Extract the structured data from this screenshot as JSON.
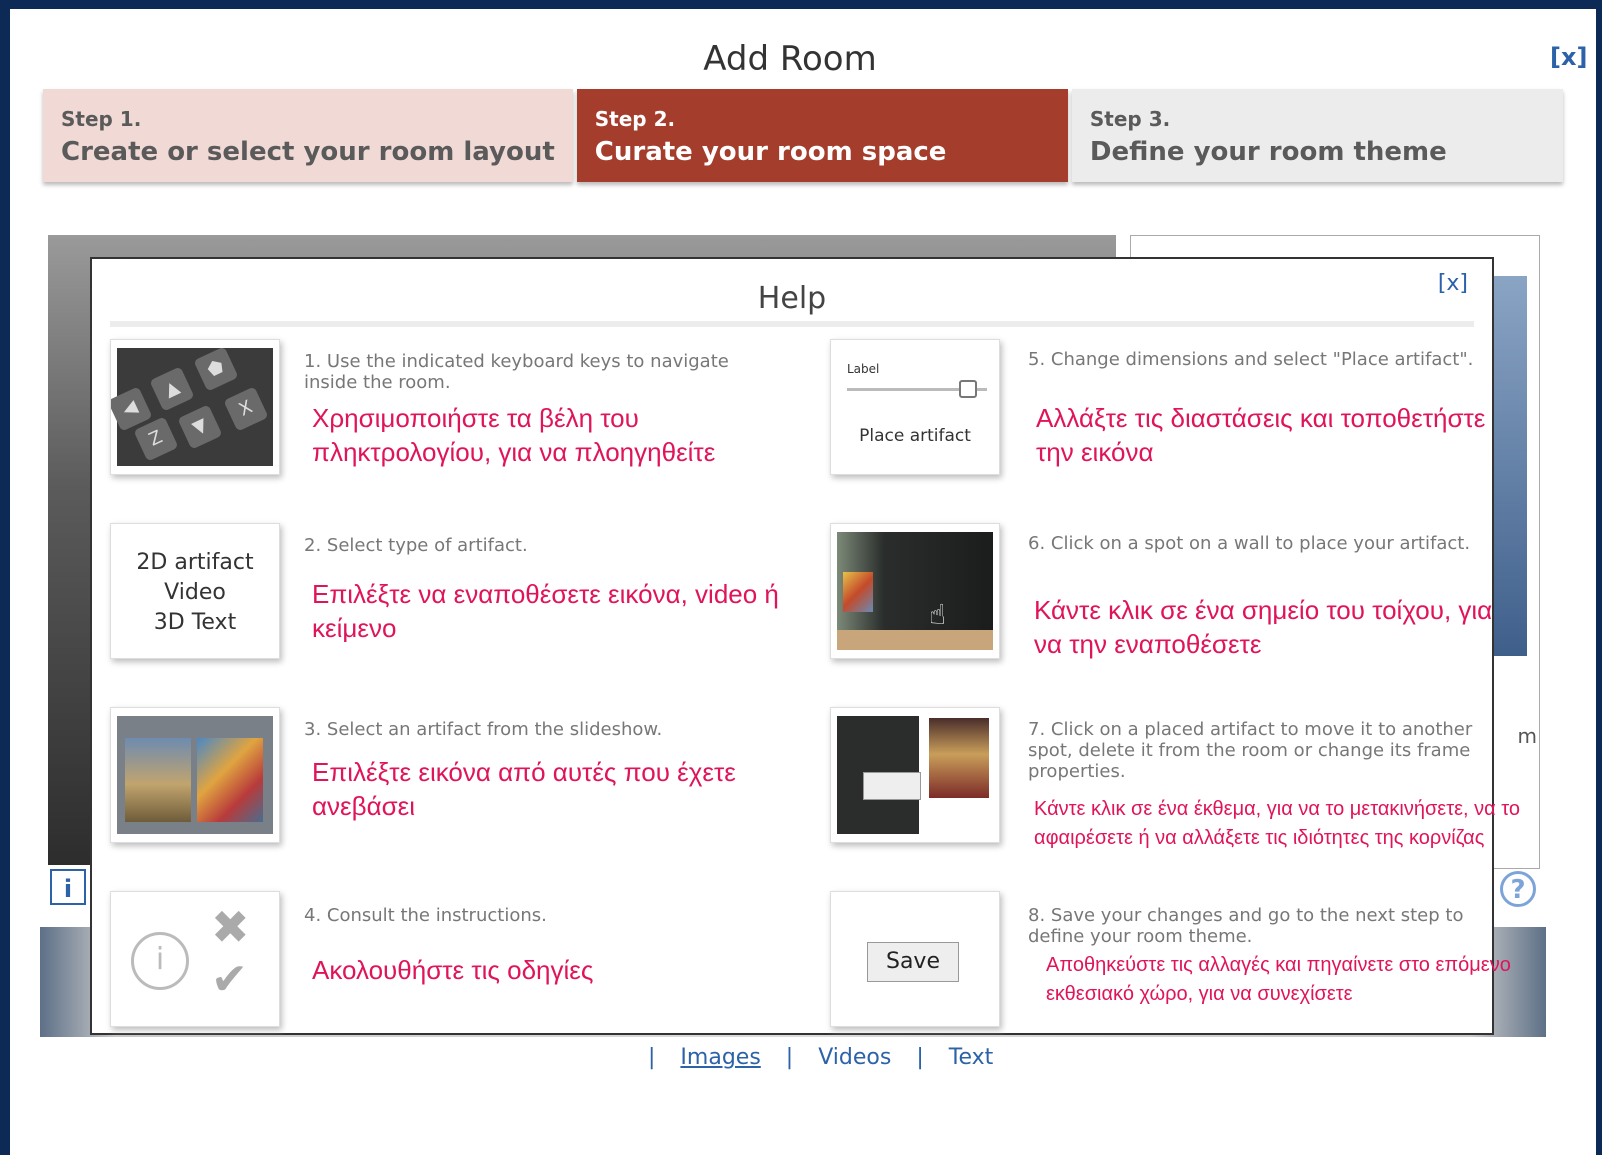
{
  "dialog": {
    "title": "Add Room",
    "close_label": "[x]"
  },
  "steps": [
    {
      "number": "Step 1.",
      "label": "Create or select your room layout",
      "state": "done"
    },
    {
      "number": "Step 2.",
      "label": "Curate your room space",
      "state": "active"
    },
    {
      "number": "Step 3.",
      "label": "Define your room theme",
      "state": "pending"
    }
  ],
  "background": {
    "info_label": "i",
    "help_label": "?",
    "partial_text": "m"
  },
  "help": {
    "title": "Help",
    "close_label": "[x]",
    "items": [
      {
        "en": "1. Use the indicated keyboard keys to navigate inside the room.",
        "gr": "Χρησιμοποιήστε τα βέλη του πληκτρολογίου, για να πλοηγηθείτε",
        "icon": "keyboard-keys-thumbnail"
      },
      {
        "en": "2. Select type of artifact.",
        "gr": "Επιλέξτε να εναποθέσετε εικόνα, video ή κείμενο",
        "icon": "artifact-type-thumbnail",
        "thumb_text": [
          "2D artifact",
          "Video",
          "3D Text"
        ]
      },
      {
        "en": "3. Select an artifact from the slideshow.",
        "gr": "Επιλέξτε εικόνα από αυτές που έχετε ανεβάσει",
        "icon": "slideshow-thumbnail"
      },
      {
        "en": "4. Consult the instructions.",
        "gr": "Ακολουθήστε τις οδηγίες",
        "icon": "instructions-thumbnail"
      },
      {
        "en": "5. Change dimensions and select \"Place artifact\".",
        "gr": "Αλλάξτε τις διαστάσεις και τοποθετήστε την εικόνα",
        "icon": "place-artifact-thumbnail",
        "thumb_label": "Label",
        "thumb_button": "Place artifact"
      },
      {
        "en": "6. Click on a spot on a wall to place your artifact.",
        "gr": "Κάντε κλικ σε ένα σημείο του τοίχου, για να την εναποθέσετε",
        "icon": "wall-spot-thumbnail"
      },
      {
        "en": "7. Click on a placed artifact to move it to another spot, delete it from the room or change its frame properties.",
        "gr": "Κάντε κλικ σε ένα έκθεμα, για να το μετακινήσετε, να το αφαιρέσετε ή να αλλάξετε τις ιδιότητες της κορνίζας",
        "icon": "move-artifact-thumbnail"
      },
      {
        "en": "8. Save your changes and go to the next step to define your room theme.",
        "gr": "Αποθηκεύστε τις αλλαγές και πηγαίνετε στο επόμενο εκθεσιακό χώρο, για να συνεχίσετε",
        "icon": "save-thumbnail",
        "thumb_button": "Save"
      }
    ]
  },
  "bottom_links": {
    "separator": "|",
    "images": "Images",
    "videos": "Videos",
    "text": "Text",
    "active": "Images"
  }
}
